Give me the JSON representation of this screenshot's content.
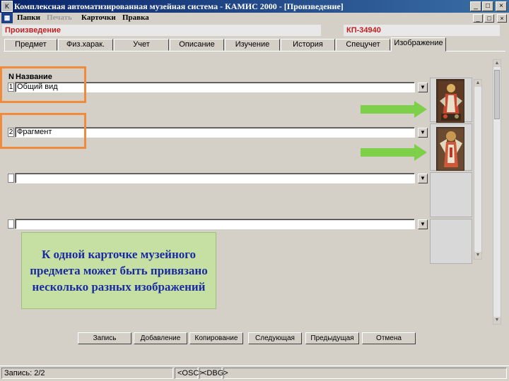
{
  "window": {
    "title": "Комплексная автоматизированная музейная система - КАМИС 2000 - [Произведение]",
    "controls": [
      "_",
      "□",
      "×"
    ]
  },
  "menu": {
    "items": [
      {
        "label": "Папки",
        "disabled": false
      },
      {
        "label": "Печать",
        "disabled": true
      },
      {
        "label": "Карточки",
        "disabled": false
      },
      {
        "label": "Правка",
        "disabled": false
      }
    ],
    "mdi_controls": [
      "_",
      "□",
      "×"
    ]
  },
  "header": {
    "object_type": "Произведение",
    "card_number": "КП-34940"
  },
  "tabs": [
    {
      "label": "Предмет"
    },
    {
      "label": "Физ.харак."
    },
    {
      "label": "Учет"
    },
    {
      "label": "Описание"
    },
    {
      "label": "Изучение"
    },
    {
      "label": "История"
    },
    {
      "label": "Спецучет"
    },
    {
      "label": "Изображение",
      "active": true
    }
  ],
  "grid": {
    "col_n": "N",
    "col_name": "Название",
    "rows": [
      {
        "n": "1",
        "name": "Общий вид",
        "has_image": true
      },
      {
        "n": "2",
        "name": "Фрагмент",
        "has_image": true
      },
      {
        "n": "",
        "name": "",
        "has_image": false
      },
      {
        "n": "",
        "name": "",
        "has_image": false
      }
    ]
  },
  "callout": {
    "text": "К одной карточке музейного предмета может быть привязано несколько разных изображений"
  },
  "colors": {
    "accent_orange": "#f08a3c",
    "arrow_green": "#7ed04a",
    "callout_bg": "#c6e0a4",
    "callout_text": "#1a2aa0",
    "header_red": "#c02020"
  },
  "buttons": [
    {
      "label": "Запись"
    },
    {
      "label": "Добавление"
    },
    {
      "label": "Копирование"
    },
    {
      "label": "Следующая"
    },
    {
      "label": "Предыдущая"
    },
    {
      "label": "Отмена"
    }
  ],
  "status": {
    "record": "Запись: 2/2",
    "osc": "<OSC>",
    "dbg": "<DBG>"
  }
}
